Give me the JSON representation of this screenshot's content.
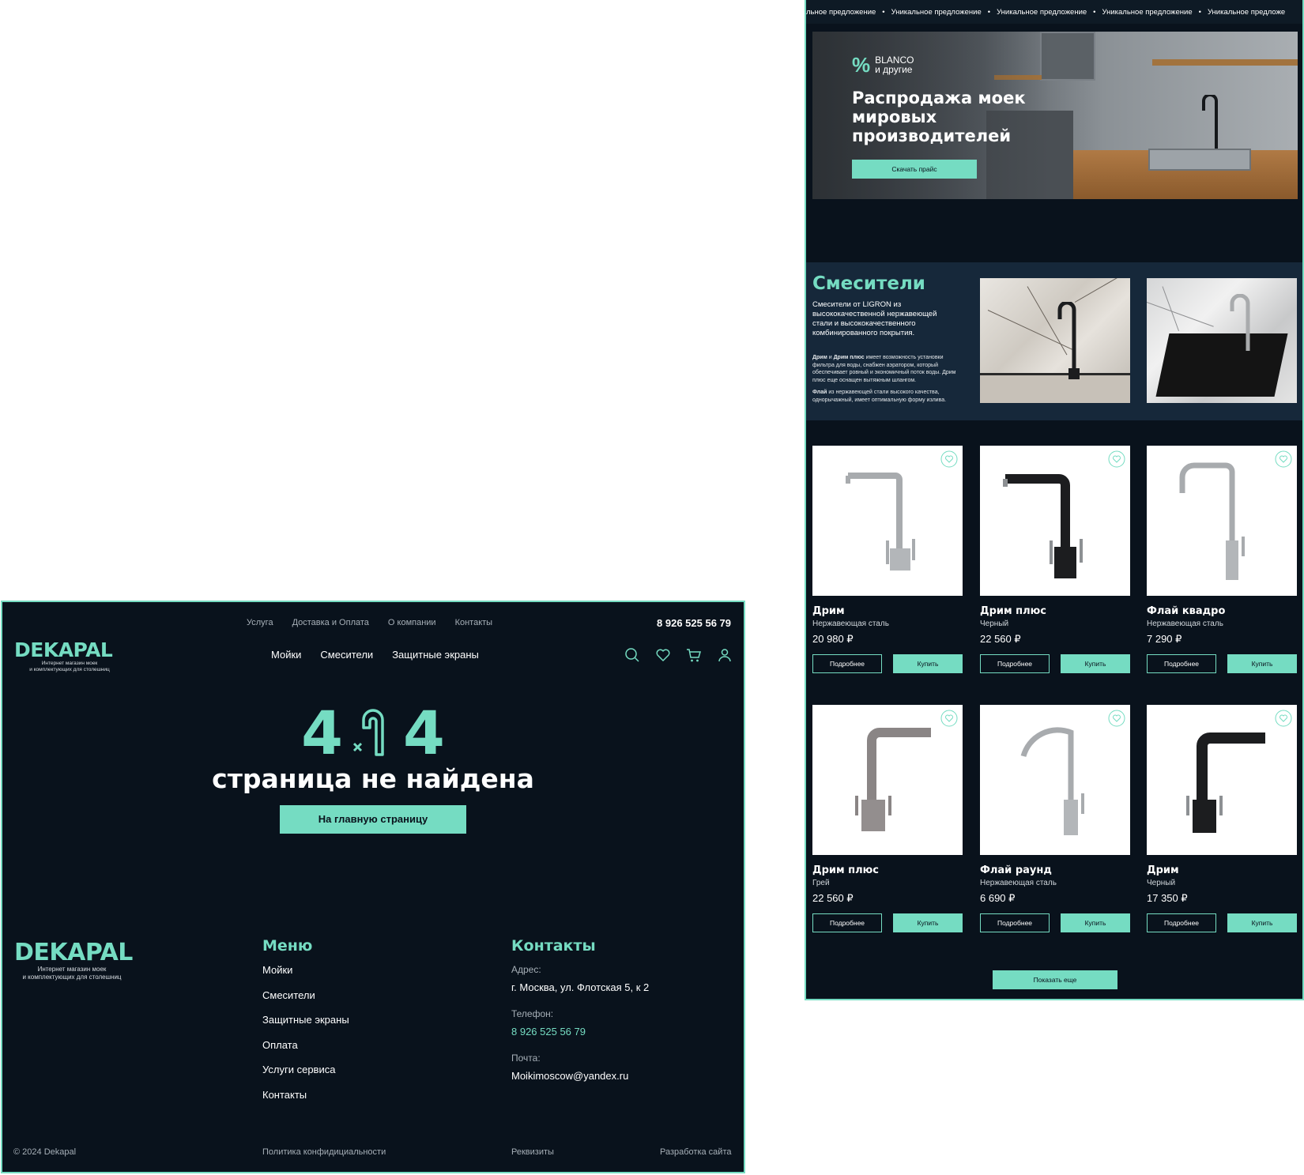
{
  "page404": {
    "topnav": [
      "Услуга",
      "Доставка и Оплата",
      "О компании",
      "Контакты"
    ],
    "phone": "8 926 525 56 79",
    "logo": {
      "word": "DEKAPAL",
      "tagline1": "Интернет магазин моек",
      "tagline2": "и комплектующих для столешниц"
    },
    "mainnav": [
      "Мойки",
      "Смесители",
      "Защитные экраны"
    ],
    "icons": [
      "search-icon",
      "heart-icon",
      "cart-icon",
      "user-icon"
    ],
    "error": {
      "digit_left": "4",
      "digit_right": "4",
      "title": "страница не найдена",
      "button": "На главную страницу"
    },
    "footer": {
      "menu_title": "Меню",
      "menu": [
        "Мойки",
        "Смесители",
        "Защитные экраны",
        "Оплата",
        "Услуги сервиса",
        "Контакты"
      ],
      "contacts_title": "Контакты",
      "address_label": "Адрес:",
      "address": "г. Москва, ул. Флотская 5, к 2",
      "phone_label": "Телефон:",
      "phone": "8 926 525 56 79",
      "mail_label": "Почта:",
      "mail": "Moikimoscow@yandex.ru",
      "copyright": "© 2024 Dekapal",
      "privacy": "Политика конфидициальности",
      "requisites": "Реквизиты",
      "dev": "Разработка сайта"
    }
  },
  "shop": {
    "ticker_text": "Уникальное предложение",
    "ticker_partial": "льное предложение",
    "ticker_end": "Уникальное предложе",
    "hero": {
      "badge_pct": "%",
      "badge_line1": "BLANCO",
      "badge_line2": "и другие",
      "title": "Распродажа моек мировых производителей",
      "button": "Скачать прайс"
    },
    "mixers": {
      "title": "Смесители",
      "desc": "Смесители от LIGRON из высококачественной нержавеющей стали и высококачественного комбинированного покрытия.",
      "note1_bold1": "Дрим",
      "note1_mid": " и ",
      "note1_bold2": "Дрим плюс",
      "note1_text": " имеет возможность установки фильтра для воды, снабжен аэратором, который обеспечивает ровный и экономичный поток воды. Дрим плюс еще оснащен вытяжным шлангом.",
      "note2_bold": "Флай",
      "note2_text": " из нержавеющей стали высокого качества, однорычажный, имеет оптимальную форму излива."
    },
    "products": [
      {
        "name": "Дрим",
        "material": "Нержавеющая сталь",
        "price": "20 980 ₽"
      },
      {
        "name": "Дрим плюс",
        "material": "Черный",
        "price": "22 560 ₽"
      },
      {
        "name": "Флай квадро",
        "material": "Нержавеющая сталь",
        "price": "7 290 ₽"
      },
      {
        "name": "Дрим плюс",
        "material": "Грей",
        "price": "22 560 ₽"
      },
      {
        "name": "Флай раунд",
        "material": "Нержавеющая сталь",
        "price": "6 690 ₽"
      },
      {
        "name": "Дрим",
        "material": "Черный",
        "price": "17 350 ₽"
      }
    ],
    "btn_details": "Подробнее",
    "btn_buy": "Купить",
    "show_more": "Показать еще",
    "colors": {
      "accent": "#75dcc2",
      "background": "#09121c",
      "section": "#16283a"
    }
  }
}
